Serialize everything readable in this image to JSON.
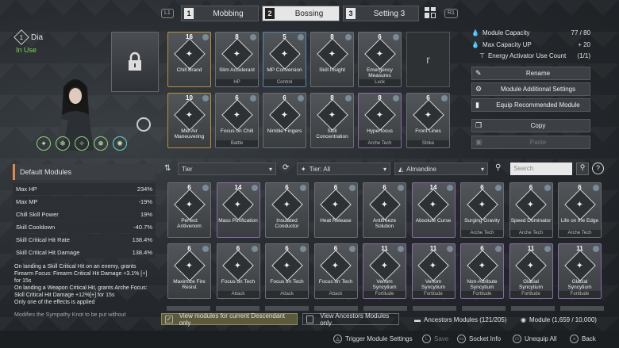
{
  "tabs": [
    {
      "num": "1",
      "label": "Mobbing"
    },
    {
      "num": "2",
      "label": "Bossing"
    },
    {
      "num": "3",
      "label": "Setting 3"
    }
  ],
  "keys": {
    "left": "L1",
    "right": "R1"
  },
  "character": {
    "num": "1",
    "name": "Dia",
    "status": "In Use"
  },
  "stats": {
    "title": "Default Modules",
    "rows": [
      {
        "k": "Max HP",
        "v": "234%"
      },
      {
        "k": "Max MP",
        "v": "-19%"
      },
      {
        "k": "Chill Skill Power",
        "v": "19%"
      },
      {
        "k": "Skill Cooldown",
        "v": "-40.7%"
      },
      {
        "k": "Skill Critical Hit Rate",
        "v": "138.4%"
      },
      {
        "k": "Skill Critical Hit Damage",
        "v": "138.4%"
      }
    ],
    "desc": "On landing a Skill Critical Hit on an enemy, grants Firearm Focus: Firearm Critical Hit Damage +3.1% [+] for 15s\nOn landing a Weapon Critical Hit, grants Arche Focus: Skill Critical Hit Damage +12%[+] for 15s\nOnly one of the effects is applied",
    "desc2": "Modifies the Sympathy Knot to be put without"
  },
  "equipped": [
    {
      "cost": "16",
      "name": "Chill Brand",
      "sub": ""
    },
    {
      "cost": "8",
      "name": "Slim Accelerant",
      "sub": "HP"
    },
    {
      "cost": "5",
      "name": "MP Conversion",
      "sub": "Control"
    },
    {
      "cost": "8",
      "name": "Skill Insight",
      "sub": ""
    },
    {
      "cost": "6",
      "name": "Emergency Measures",
      "sub": "Luck"
    },
    {
      "cost": "10",
      "name": "Mid-Air Maneuvering",
      "sub": ""
    },
    {
      "cost": "6",
      "name": "Focus on Chill",
      "sub": "Battle"
    },
    {
      "cost": "6",
      "name": "Nimble Fingers",
      "sub": ""
    },
    {
      "cost": "8",
      "name": "Skill Concentration",
      "sub": ""
    },
    {
      "cost": "8",
      "name": "Hyperfocus",
      "sub": "Arche Tech"
    },
    {
      "cost": "6",
      "name": "Front Lines",
      "sub": "Strike"
    }
  ],
  "capacity": {
    "label": "Module Capacity",
    "value": "77 / 80",
    "up_label": "Max Capacity UP",
    "up_value": "+ 20",
    "activator_label": "Energy Activator Use Count",
    "activator_value": "(1/1)"
  },
  "buttons": [
    "Rename",
    "Module Additional Settings",
    "Equip Recommended Module",
    "Copy",
    "Paste"
  ],
  "filters": {
    "sort": "Tier",
    "tier": "Tier: All",
    "socket": "Almandine",
    "search_placeholder": "Search"
  },
  "inventory": [
    {
      "cost": "6",
      "name": "Perfect Antivenom",
      "sub": ""
    },
    {
      "cost": "14",
      "name": "Mass Purification",
      "sub": ""
    },
    {
      "cost": "6",
      "name": "Insulated Conductor",
      "sub": ""
    },
    {
      "cost": "6",
      "name": "Heat Release",
      "sub": ""
    },
    {
      "cost": "6",
      "name": "Antifreeze Solution",
      "sub": ""
    },
    {
      "cost": "14",
      "name": "Absolute Curse",
      "sub": ""
    },
    {
      "cost": "6",
      "name": "Surging Gravity",
      "sub": "Arche Tech"
    },
    {
      "cost": "6",
      "name": "Speed Dominator",
      "sub": "Arche Tech"
    },
    {
      "cost": "6",
      "name": "Life on the Edge",
      "sub": "Arche Tech"
    },
    {
      "cost": "6",
      "name": "Maximize Fire Resist",
      "sub": ""
    },
    {
      "cost": "6",
      "name": "Focus on Tech",
      "sub": "Attack"
    },
    {
      "cost": "6",
      "name": "Focus on Tech",
      "sub": "Attack"
    },
    {
      "cost": "6",
      "name": "Focus on Tech",
      "sub": "Attack"
    },
    {
      "cost": "11",
      "name": "Venom Syncytium",
      "sub": "Fortitude"
    },
    {
      "cost": "11",
      "name": "Venom Syncytium",
      "sub": "Fortitude"
    },
    {
      "cost": "6",
      "name": "Non-Attribute Syncytium",
      "sub": "Fortitude"
    },
    {
      "cost": "11",
      "name": "Glacial Syncytium",
      "sub": "Fortitude"
    },
    {
      "cost": "11",
      "name": "Glacial Syncytium",
      "sub": "Fortitude"
    }
  ],
  "bottom": {
    "chk1": "View modules for current Descendant only",
    "chk2": "View Ancestors Modules only",
    "ancestors": "Ancestors Modules (121/205)",
    "modules": "Module (1,659 / 10,000)"
  },
  "hints": [
    "Trigger Module Settings",
    "Save",
    "Socket Info",
    "Unequip All",
    "Back"
  ]
}
